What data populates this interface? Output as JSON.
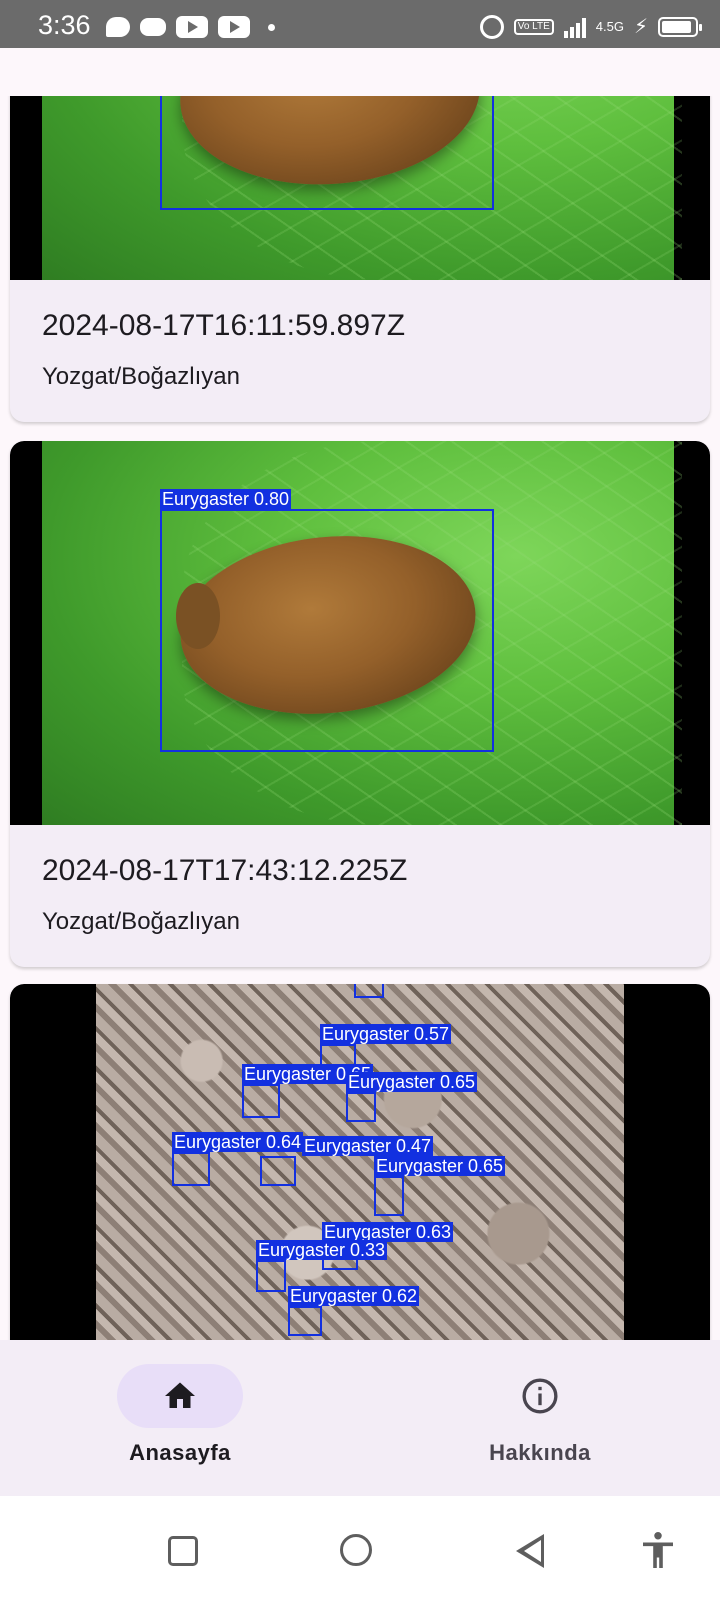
{
  "status_bar": {
    "time": "3:36",
    "network": "4.5G",
    "volte": "Vo LTE",
    "battery_level": 0.9
  },
  "posts": [
    {
      "date": "2024-08-17T16:11:59.897Z",
      "location": "Yozgat/Boğazlıyan",
      "detections": []
    },
    {
      "date": "2024-08-17T17:43:12.225Z",
      "location": "Yozgat/Boğazlıyan",
      "detections": [
        "Eurygaster 0.80"
      ]
    },
    {
      "detections": [
        "Eurygaster 0.57",
        "Eurygaster 0.65",
        "Eurygaster 0.65",
        "Eurygaster 0.64",
        "Eurygaster 0.47",
        "Eurygaster 0.65",
        "Eurygaster 0.63",
        "Eurygaster 0.33",
        "Eurygaster 0.62"
      ]
    }
  ],
  "bottom_nav": {
    "items": [
      {
        "label": "Anasayfa",
        "icon": "home-icon",
        "selected": true
      },
      {
        "label": "Hakkında",
        "icon": "info-icon",
        "selected": false
      }
    ]
  },
  "colors": {
    "bbox": "#1230e0",
    "selected_pill": "#e8def8",
    "card_bg": "#f3edf6"
  }
}
